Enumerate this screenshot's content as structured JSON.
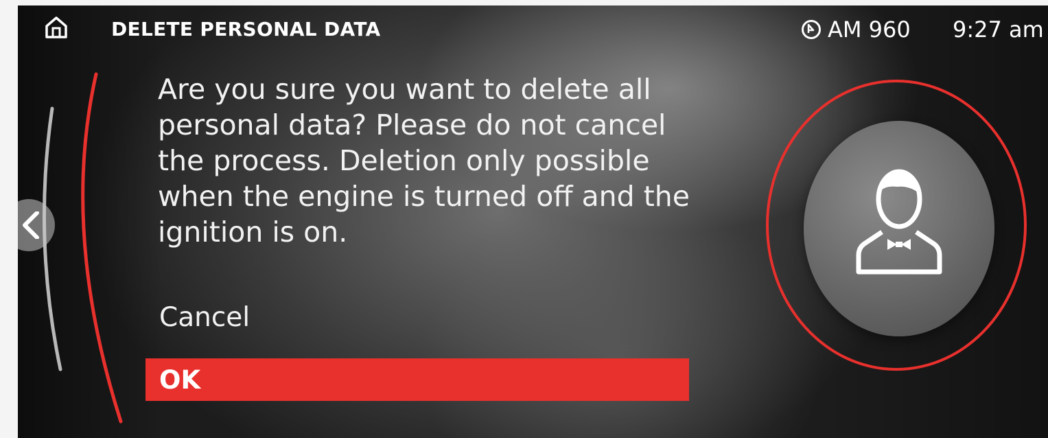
{
  "header": {
    "title": "DELETE PERSONAL DATA",
    "home_icon": "home-icon",
    "radio_icon": "radio-preset-icon",
    "radio_station": "AM 960",
    "clock": "9:27 am"
  },
  "dialog": {
    "message": "Are you sure you want to delete all personal data? Please do not cancel the process. Deletion only possible when the engine is turned off and the ignition is on.",
    "options": [
      {
        "label": "Cancel",
        "selected": false
      },
      {
        "label": "OK",
        "selected": true
      }
    ]
  },
  "profile": {
    "icon": "user-profile-icon"
  },
  "navigation": {
    "back_icon": "chevron-left-icon"
  },
  "colors": {
    "accent": "#e8302d",
    "text": "#ffffff",
    "background": "#2a2a2a"
  }
}
